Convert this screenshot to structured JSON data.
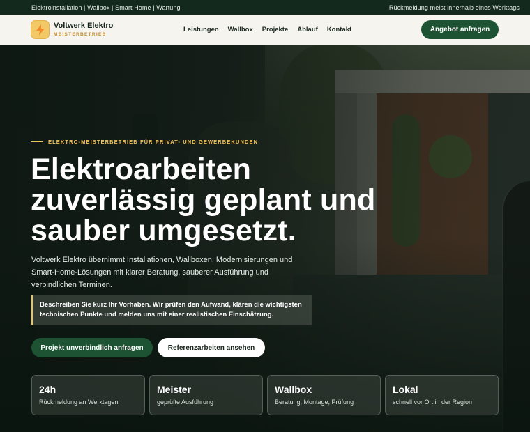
{
  "topbar": {
    "left": "Elektroinstallation | Wallbox | Smart Home | Wartung",
    "right": "Rückmeldung meist innerhalb eines Werktags"
  },
  "header": {
    "brand_name": "Voltwerk Elektro",
    "brand_sub": "MEISTERBETRIEB",
    "nav": [
      "Leistungen",
      "Wallbox",
      "Projekte",
      "Ablauf",
      "Kontakt"
    ],
    "cta": "Angebot anfragen"
  },
  "hero": {
    "eyebrow": "ELEKTRO-MEISTERBETRIEB FÜR PRIVAT- UND GEWERBEKUNDEN",
    "headline": "Elektroarbeiten zuverlässig geplant und sauber umgesetzt.",
    "lead": "Voltwerk Elektro übernimmt Installationen, Wallboxen, Modernisierungen und Smart-Home-Lösungen mit klarer Beratung, sauberer Ausführung und verbindlichen Terminen.",
    "note": "Beschreiben Sie kurz Ihr Vorhaben. Wir prüfen den Aufwand, klären die wichtigsten technischen Punkte und melden uns mit einer realistischen Einschätzung.",
    "primary_button": "Projekt unverbindlich anfragen",
    "secondary_button": "Referenzarbeiten ansehen"
  },
  "stats": [
    {
      "big": "24h",
      "small": "Rückmeldung an Werktagen"
    },
    {
      "big": "Meister",
      "small": "geprüfte Ausführung"
    },
    {
      "big": "Wallbox",
      "small": "Beratung, Montage, Prüfung"
    },
    {
      "big": "Lokal",
      "small": "schnell vor Ort in der Region"
    }
  ],
  "colors": {
    "brand_green": "#1d5233",
    "accent_gold": "#f0c25a",
    "topbar": "#14291d"
  },
  "icons": {
    "logo": "lightning-bolt-icon"
  }
}
